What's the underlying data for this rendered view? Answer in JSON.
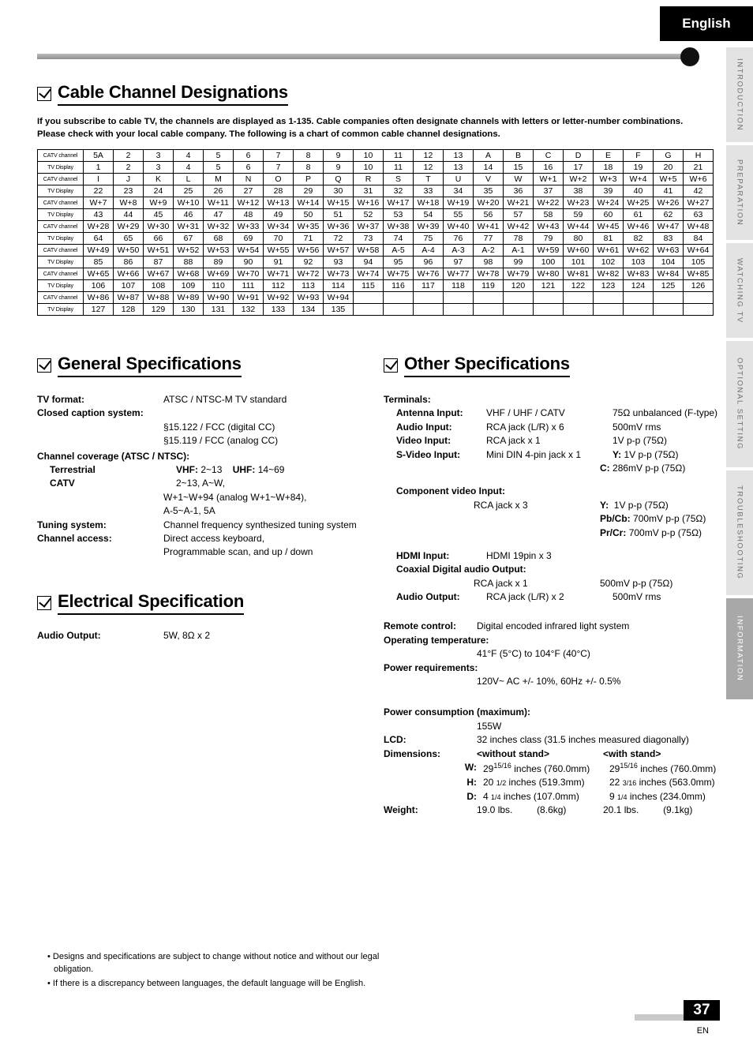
{
  "language_tab": "English",
  "side_tabs": [
    {
      "label": "INTRODUCTION",
      "active": false
    },
    {
      "label": "PREPARATION",
      "active": false
    },
    {
      "label": "WATCHING  TV",
      "active": false
    },
    {
      "label": "OPTIONAL  SETTING",
      "active": false
    },
    {
      "label": "TROUBLESHOOTING",
      "active": false
    },
    {
      "label": "INFORMATION",
      "active": true
    }
  ],
  "cable": {
    "title": "Cable Channel Designations",
    "description": "If you subscribe to cable TV, the channels are displayed as 1-135. Cable companies often designate channels with letters or letter-number combinations. Please check with your local cable company. The following is a chart of common cable channel designations.",
    "row_labels": {
      "catv": "CATV channel",
      "tv": "TV Display"
    },
    "rows": [
      [
        "5A",
        "2",
        "3",
        "4",
        "5",
        "6",
        "7",
        "8",
        "9",
        "10",
        "11",
        "12",
        "13",
        "A",
        "B",
        "C",
        "D",
        "E",
        "F",
        "G",
        "H"
      ],
      [
        "1",
        "2",
        "3",
        "4",
        "5",
        "6",
        "7",
        "8",
        "9",
        "10",
        "11",
        "12",
        "13",
        "14",
        "15",
        "16",
        "17",
        "18",
        "19",
        "20",
        "21"
      ],
      [
        "I",
        "J",
        "K",
        "L",
        "M",
        "N",
        "O",
        "P",
        "Q",
        "R",
        "S",
        "T",
        "U",
        "V",
        "W",
        "W+1",
        "W+2",
        "W+3",
        "W+4",
        "W+5",
        "W+6"
      ],
      [
        "22",
        "23",
        "24",
        "25",
        "26",
        "27",
        "28",
        "29",
        "30",
        "31",
        "32",
        "33",
        "34",
        "35",
        "36",
        "37",
        "38",
        "39",
        "40",
        "41",
        "42"
      ],
      [
        "W+7",
        "W+8",
        "W+9",
        "W+10",
        "W+11",
        "W+12",
        "W+13",
        "W+14",
        "W+15",
        "W+16",
        "W+17",
        "W+18",
        "W+19",
        "W+20",
        "W+21",
        "W+22",
        "W+23",
        "W+24",
        "W+25",
        "W+26",
        "W+27"
      ],
      [
        "43",
        "44",
        "45",
        "46",
        "47",
        "48",
        "49",
        "50",
        "51",
        "52",
        "53",
        "54",
        "55",
        "56",
        "57",
        "58",
        "59",
        "60",
        "61",
        "62",
        "63"
      ],
      [
        "W+28",
        "W+29",
        "W+30",
        "W+31",
        "W+32",
        "W+33",
        "W+34",
        "W+35",
        "W+36",
        "W+37",
        "W+38",
        "W+39",
        "W+40",
        "W+41",
        "W+42",
        "W+43",
        "W+44",
        "W+45",
        "W+46",
        "W+47",
        "W+48"
      ],
      [
        "64",
        "65",
        "66",
        "67",
        "68",
        "69",
        "70",
        "71",
        "72",
        "73",
        "74",
        "75",
        "76",
        "77",
        "78",
        "79",
        "80",
        "81",
        "82",
        "83",
        "84"
      ],
      [
        "W+49",
        "W+50",
        "W+51",
        "W+52",
        "W+53",
        "W+54",
        "W+55",
        "W+56",
        "W+57",
        "W+58",
        "A-5",
        "A-4",
        "A-3",
        "A-2",
        "A-1",
        "W+59",
        "W+60",
        "W+61",
        "W+62",
        "W+63",
        "W+64"
      ],
      [
        "85",
        "86",
        "87",
        "88",
        "89",
        "90",
        "91",
        "92",
        "93",
        "94",
        "95",
        "96",
        "97",
        "98",
        "99",
        "100",
        "101",
        "102",
        "103",
        "104",
        "105"
      ],
      [
        "W+65",
        "W+66",
        "W+67",
        "W+68",
        "W+69",
        "W+70",
        "W+71",
        "W+72",
        "W+73",
        "W+74",
        "W+75",
        "W+76",
        "W+77",
        "W+78",
        "W+79",
        "W+80",
        "W+81",
        "W+82",
        "W+83",
        "W+84",
        "W+85"
      ],
      [
        "106",
        "107",
        "108",
        "109",
        "110",
        "111",
        "112",
        "113",
        "114",
        "115",
        "116",
        "117",
        "118",
        "119",
        "120",
        "121",
        "122",
        "123",
        "124",
        "125",
        "126"
      ],
      [
        "W+86",
        "W+87",
        "W+88",
        "W+89",
        "W+90",
        "W+91",
        "W+92",
        "W+93",
        "W+94",
        "",
        "",
        "",
        "",
        "",
        "",
        "",
        "",
        "",
        "",
        "",
        ""
      ],
      [
        "127",
        "128",
        "129",
        "130",
        "131",
        "132",
        "133",
        "134",
        "135",
        "",
        "",
        "",
        "",
        "",
        "",
        "",
        "",
        "",
        "",
        "",
        ""
      ]
    ]
  },
  "general": {
    "title": "General Specifications",
    "tv_format_label": "TV format:",
    "tv_format_value": "ATSC / NTSC-M TV standard",
    "closed_caption_label": "Closed caption system:",
    "closed_caption_line1": "§15.122 / FCC (digital CC)",
    "closed_caption_line2": "§15.119 / FCC (analog CC)",
    "channel_coverage_label": "Channel coverage (ATSC / NTSC):",
    "terrestrial_label": "Terrestrial",
    "terrestrial_vhf": "VHF:",
    "terrestrial_vhf_value": "2~13",
    "terrestrial_uhf": "UHF:",
    "terrestrial_uhf_value": "14~69",
    "catv_label": "CATV",
    "catv_line1": "2~13, A~W,",
    "catv_line2": "W+1~W+94 (analog W+1~W+84),",
    "catv_line3": "A-5~A-1, 5A",
    "tuning_label": "Tuning system:",
    "tuning_value": "Channel frequency synthesized tuning system",
    "access_label": "Channel access:",
    "access_line1": "Direct access keyboard,",
    "access_line2": "Programmable scan, and up / down"
  },
  "electrical": {
    "title": "Electrical Specification",
    "audio_output_label": "Audio Output:",
    "audio_output_value": "5W, 8Ω x 2"
  },
  "other": {
    "title": "Other Specifications",
    "terminals_label": "Terminals:",
    "antenna_label": "Antenna Input:",
    "antenna_value": "VHF / UHF / CATV",
    "antenna_spec": "75Ω unbalanced (F-type)",
    "audio_in_label": "Audio Input:",
    "audio_in_value": "RCA jack (L/R) x 6",
    "audio_in_spec": "500mV rms",
    "video_in_label": "Video Input:",
    "video_in_value": "RCA jack x 1",
    "video_in_spec": "1V p-p (75Ω)",
    "svideo_label": "S-Video Input:",
    "svideo_value": "Mini DIN 4-pin jack x 1",
    "svideo_spec_y_key": "Y:",
    "svideo_spec_y_val": "1V p-p (75Ω)",
    "svideo_spec_c_key": "C:",
    "svideo_spec_c_val": "286mV p-p (75Ω)",
    "component_label": "Component video Input:",
    "component_value": "RCA jack x 3",
    "component_y_key": "Y:",
    "component_y_val": "1V p-p (75Ω)",
    "component_pb_key": "Pb/Cb:",
    "component_pb_val": "700mV p-p (75Ω)",
    "component_pr_key": "Pr/Cr:",
    "component_pr_val": "700mV p-p (75Ω)",
    "hdmi_label": "HDMI Input:",
    "hdmi_value": "HDMI 19pin x 3",
    "coaxial_label": "Coaxial Digital audio Output:",
    "coaxial_value": "RCA jack x 1",
    "coaxial_spec": "500mV p-p (75Ω)",
    "audio_out_label": "Audio Output:",
    "audio_out_value": "RCA jack (L/R) x 2",
    "audio_out_spec": "500mV rms",
    "remote_label": "Remote control:",
    "remote_value": "Digital encoded infrared light system",
    "op_temp_label": "Operating temperature:",
    "op_temp_value": "41°F (5°C) to 104°F (40°C)",
    "power_req_label": "Power requirements:",
    "power_req_value": "120V~ AC +/- 10%, 60Hz +/- 0.5%",
    "power_cons_label": "Power consumption (maximum):",
    "power_cons_value": "155W",
    "lcd_label": "LCD:",
    "lcd_value": "32 inches class  (31.5 inches measured diagonally)",
    "dimensions_label": "Dimensions:",
    "without_stand": "<without stand>",
    "with_stand": "<with stand>",
    "w_key": "W:",
    "w_without_int": "29",
    "w_without_frac": "15/16",
    "w_without_rest": " inches (760.0mm)",
    "w_with_int": "29",
    "w_with_frac": "15/16",
    "w_with_rest": " inches (760.0mm)",
    "h_key": "H:",
    "h_without_int": "20",
    "h_without_frac": "1/2",
    "h_without_rest": " inches  (519.3mm)",
    "h_with_int": "22",
    "h_with_frac": "3/16",
    "h_with_rest": " inches  (563.0mm)",
    "d_key": "D:",
    "d_without_int": "4",
    "d_without_frac": "1/4",
    "d_without_rest": " inches   (107.0mm)",
    "d_with_int": "9",
    "d_with_frac": "1/4",
    "d_with_rest": " inches   (234.0mm)",
    "weight_label": "Weight:",
    "weight_without": "19.0 lbs.",
    "weight_without_kg": "(8.6kg)",
    "weight_with": "20.1 lbs.",
    "weight_with_kg": "(9.1kg)"
  },
  "notes": [
    "• Designs and specifications are subject to change without notice and without our legal obligation.",
    "• If there is a discrepancy between languages, the default language will be English."
  ],
  "footer": {
    "page_number": "37",
    "page_code": "EN"
  }
}
